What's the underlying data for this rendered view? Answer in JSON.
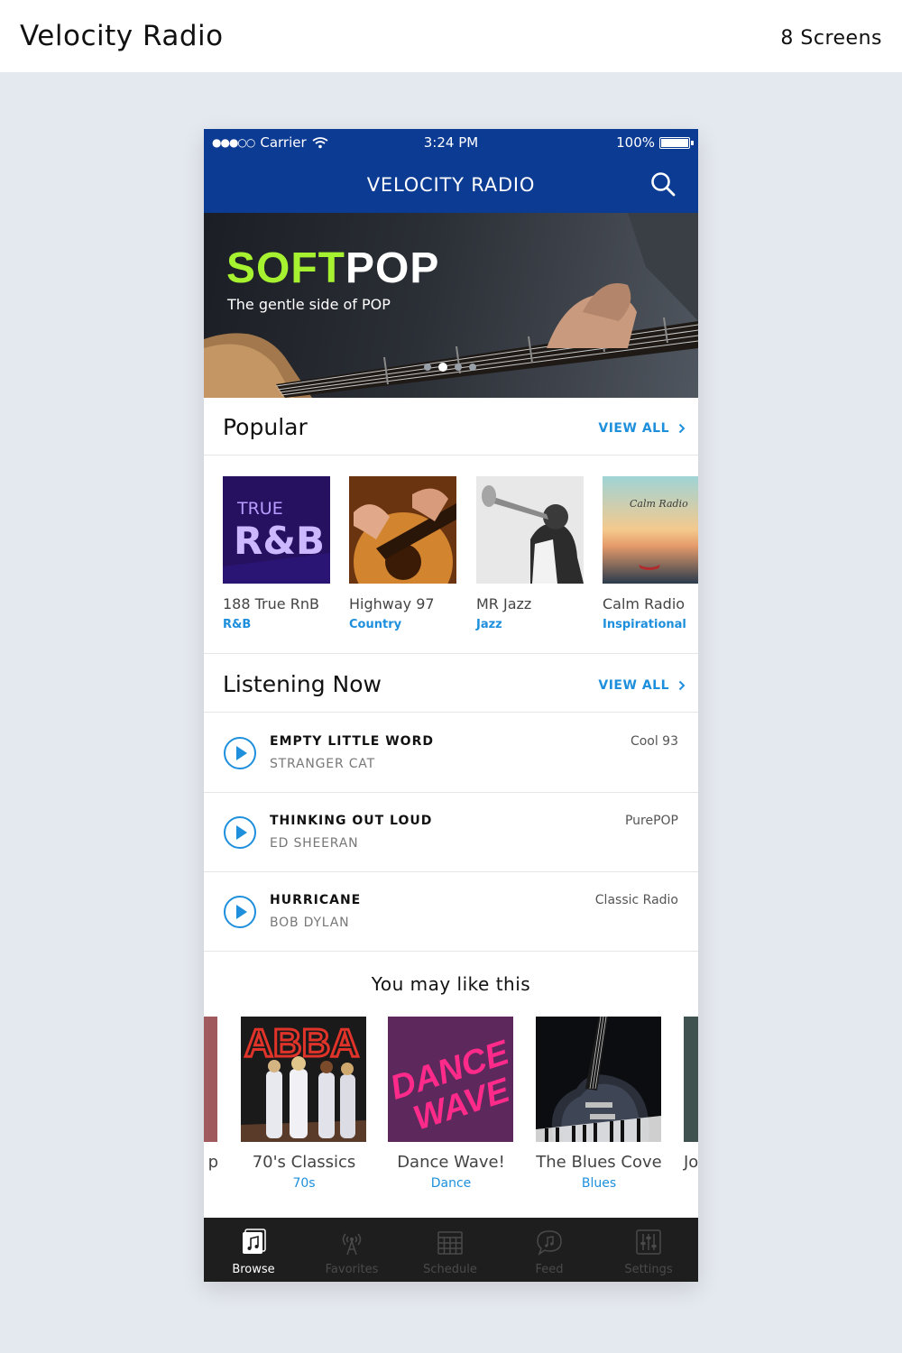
{
  "page": {
    "title": "Velocity Radio",
    "screens": "8 Screens"
  },
  "status_bar": {
    "carrier": "Carrier",
    "time": "3:24 PM",
    "battery": "100%"
  },
  "app": {
    "title": "VELOCITY RADIO"
  },
  "hero": {
    "title_a": "SOFT",
    "title_b": "POP",
    "subtitle": "The gentle side of POP",
    "active_dot": 2,
    "dot_count": 4
  },
  "popular": {
    "title": "Popular",
    "view_all": "VIEW ALL",
    "items": [
      {
        "name": "188 True RnB",
        "genre": "R&B",
        "art_line1": "TRUE",
        "art_line2": "R&B"
      },
      {
        "name": "Highway 97",
        "genre": "Country"
      },
      {
        "name": "MR Jazz",
        "genre": "Jazz"
      },
      {
        "name": "Calm Radio",
        "genre": "Inspirational",
        "art_text": "Calm Radio"
      }
    ]
  },
  "listening": {
    "title": "Listening Now",
    "view_all": "VIEW ALL",
    "tracks": [
      {
        "title": "EMPTY LITTLE WORD",
        "artist": "STRANGER CAT",
        "station": "Cool 93"
      },
      {
        "title": "THINKING OUT LOUD",
        "artist": "ED SHEERAN",
        "station": "PurePOP"
      },
      {
        "title": "HURRICANE",
        "artist": "BOB DYLAN",
        "station": "Classic Radio"
      }
    ]
  },
  "recommend": {
    "title": "You may like this",
    "items": [
      {
        "name": "70's Classics",
        "genre": "70s",
        "art_text": "ABBA"
      },
      {
        "name": "Dance Wave!",
        "genre": "Dance",
        "art_line1": "DANCE",
        "art_line2": "WAVE"
      },
      {
        "name": "The Blues Cove",
        "genre": "Blues"
      }
    ],
    "partial_left": "p",
    "partial_right": "Jo"
  },
  "tabs": [
    {
      "label": "Browse",
      "icon": "music-note-icon",
      "active": true
    },
    {
      "label": "Favorites",
      "icon": "broadcast-icon",
      "active": false
    },
    {
      "label": "Schedule",
      "icon": "calendar-icon",
      "active": false
    },
    {
      "label": "Feed",
      "icon": "chat-bubble-icon",
      "active": false
    },
    {
      "label": "Settings",
      "icon": "sliders-icon",
      "active": false
    }
  ],
  "colors": {
    "brand": "#0c3b93",
    "accent": "#1e8fdc",
    "highlight": "#a6f230",
    "tabbar": "#1e1e1e"
  }
}
